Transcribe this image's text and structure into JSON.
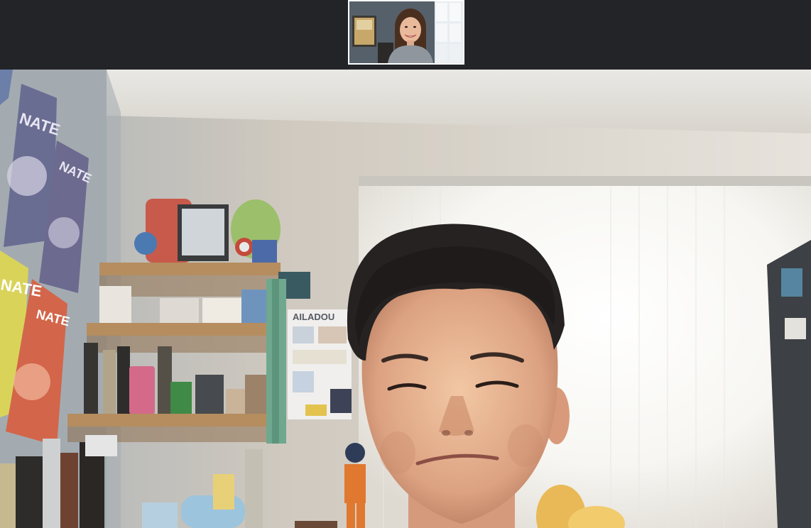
{
  "window": {
    "background_color": "#232427",
    "thumbnail_border_color": "#ffffff"
  },
  "thumbnail": {
    "participant": "self-view-teacher"
  },
  "main_video": {
    "participant": "speaker-student",
    "posters": [
      {
        "text": "NATE"
      },
      {
        "text": "NATE"
      },
      {
        "text": "NATE"
      },
      {
        "text": "NATE"
      }
    ],
    "wall_sign": {
      "text": "AILADOU"
    }
  }
}
